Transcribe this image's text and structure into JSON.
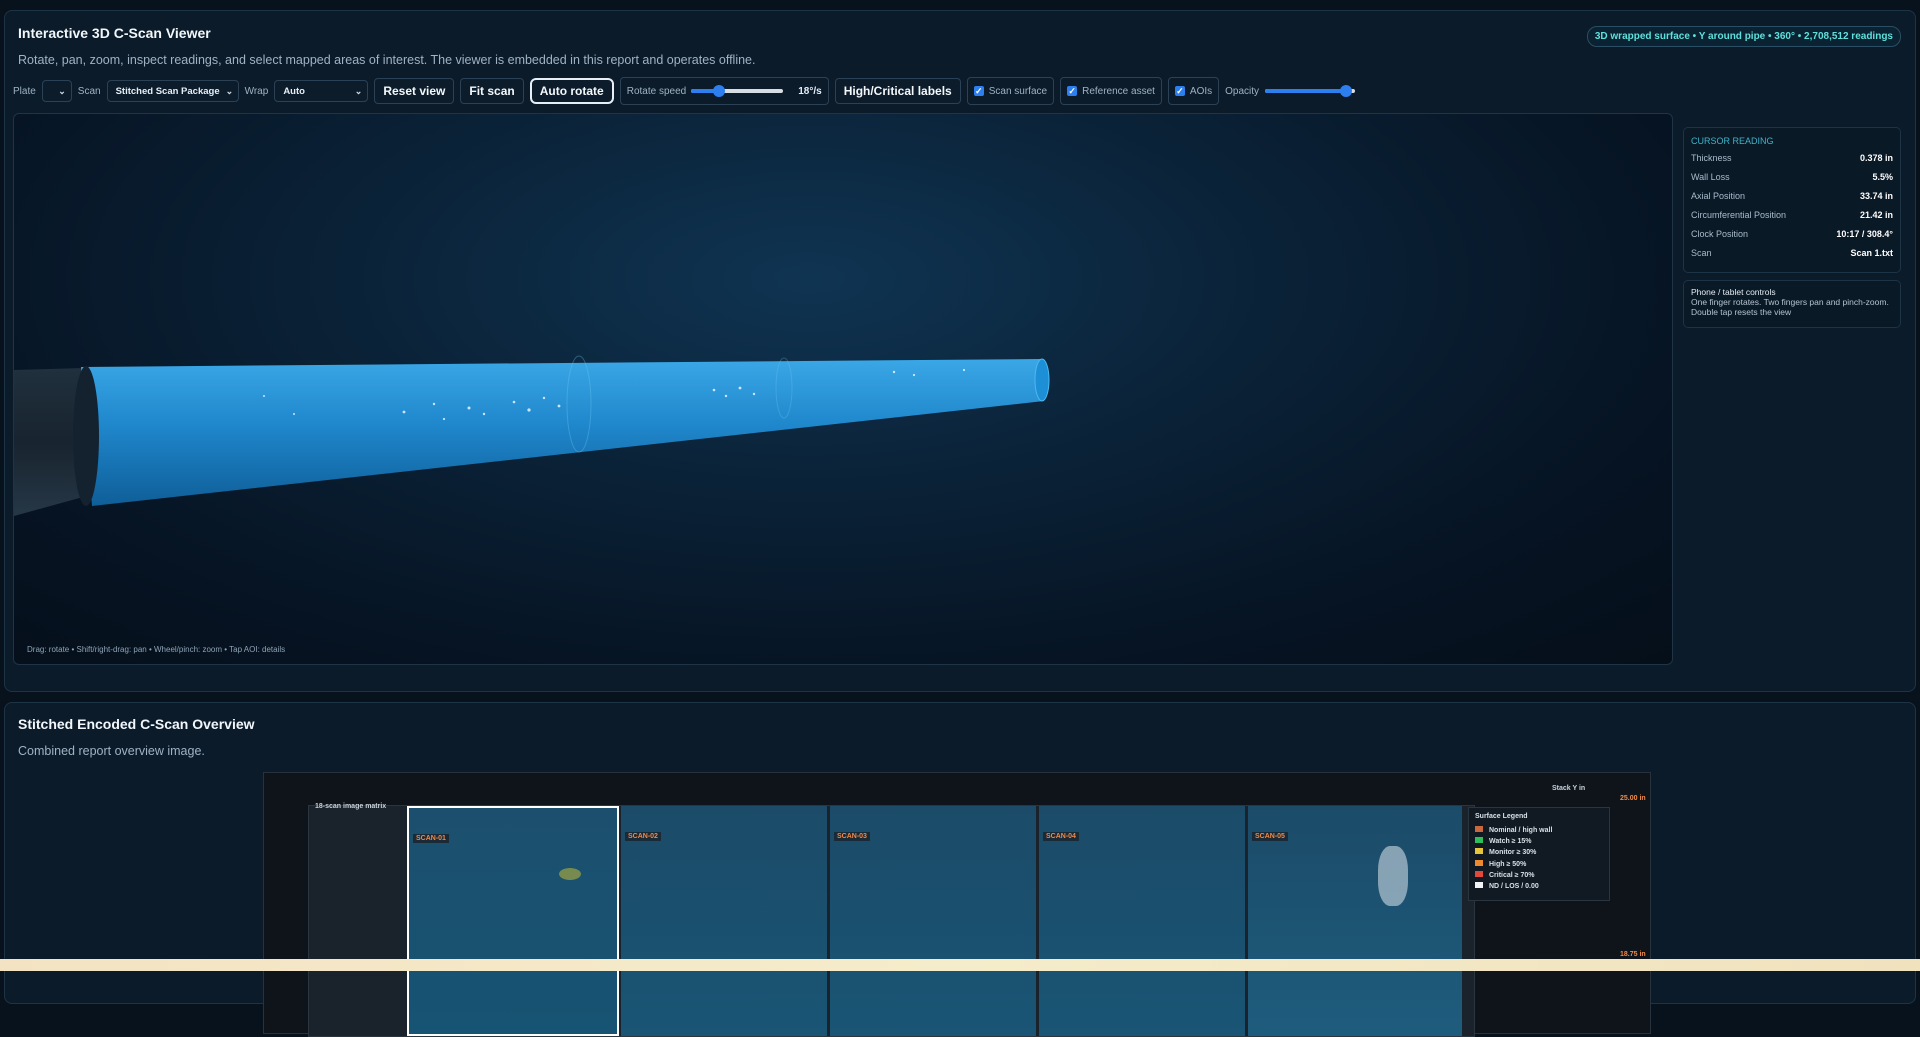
{
  "viewer": {
    "title": "Interactive 3D C-Scan Viewer",
    "subtitle": "Rotate, pan, zoom, inspect readings, and select mapped areas of interest. The viewer is embedded in this report and operates offline.",
    "summary_chip": "3D wrapped surface • Y around pipe • 360° • 2,708,512 readings",
    "toolbar": {
      "plate_label": "Plate",
      "plate_value": "",
      "scan_label": "Scan",
      "scan_value": "Stitched Scan Package",
      "wrap_label": "Wrap",
      "wrap_value": "Auto",
      "reset_view": "Reset view",
      "fit_scan": "Fit scan",
      "auto_rotate": "Auto rotate",
      "rotate_speed_label": "Rotate speed",
      "rotate_speed_value": "18°/s",
      "rotate_speed_fraction": 0.3,
      "labels_button": "High/Critical labels",
      "scan_surface": "Scan surface",
      "reference_asset": "Reference asset",
      "aois": "AOIs",
      "opacity_label": "Opacity",
      "opacity_fraction": 0.9
    },
    "scene_hint": "Drag: rotate • Shift/right-drag: pan • Wheel/pinch: zoom • Tap AOI: details"
  },
  "cursor_reading": {
    "heading": "CURSOR READING",
    "rows": [
      {
        "label": "Thickness",
        "value": "0.378 in"
      },
      {
        "label": "Wall Loss",
        "value": "5.5%"
      },
      {
        "label": "Axial Position",
        "value": "33.74 in"
      },
      {
        "label": "Circumferential Position",
        "value": "21.42 in"
      },
      {
        "label": "Clock Position",
        "value": "10:17 / 308.4°"
      },
      {
        "label": "Scan",
        "value": "Scan 1.txt"
      }
    ]
  },
  "controls_note": {
    "title": "Phone / tablet controls",
    "text": "One finger rotates. Two fingers pan and pinch-zoom. Double tap resets the view"
  },
  "overview": {
    "title": "Stitched Encoded C-Scan Overview",
    "subtitle": "Combined report overview image.",
    "matrix_label": "18-scan image matrix",
    "stack_label": "Stack Y in",
    "axis_top": "25.00 in",
    "axis_bottom": "18.75 in",
    "scans": [
      "SCAN-01",
      "SCAN-02",
      "SCAN-03",
      "SCAN-04",
      "SCAN-05"
    ],
    "legend_title": "Surface Legend",
    "legend": [
      {
        "label": "Nominal / high wall",
        "color": "#c9683c"
      },
      {
        "label": "Watch ≥ 15%",
        "color": "#2fbf5a"
      },
      {
        "label": "Monitor ≥ 30%",
        "color": "#e8c438"
      },
      {
        "label": "High ≥ 50%",
        "color": "#f08a2c"
      },
      {
        "label": "Critical ≥ 70%",
        "color": "#e0493c"
      },
      {
        "label": "ND / LOS / 0.00",
        "color": "#f2f4f6"
      }
    ]
  }
}
